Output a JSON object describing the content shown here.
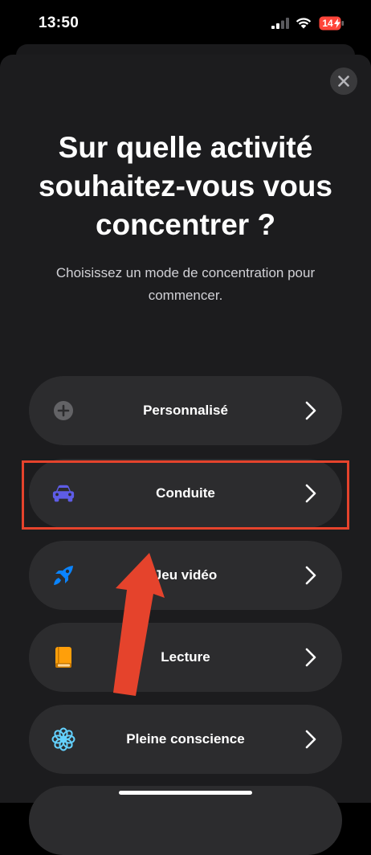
{
  "status_bar": {
    "time": "13:50",
    "battery": "14"
  },
  "sheet": {
    "title": "Sur quelle activité souhaitez-vous vous concentrer ?",
    "subtitle": "Choisissez un mode de concentration pour commencer."
  },
  "modes": [
    {
      "label": "Personnalisé",
      "icon": "plus-circle-icon",
      "color": "#8e8e93"
    },
    {
      "label": "Conduite",
      "icon": "car-icon",
      "color": "#5e5ce6"
    },
    {
      "label": "Jeu vidéo",
      "icon": "rocket-icon",
      "color": "#0a84ff"
    },
    {
      "label": "Lecture",
      "icon": "book-icon",
      "color": "#ff9f0a"
    },
    {
      "label": "Pleine conscience",
      "icon": "flower-icon",
      "color": "#64d2ff"
    }
  ],
  "annotation": {
    "highlight_color": "#e5432c",
    "highlighted_mode": "Conduite"
  }
}
